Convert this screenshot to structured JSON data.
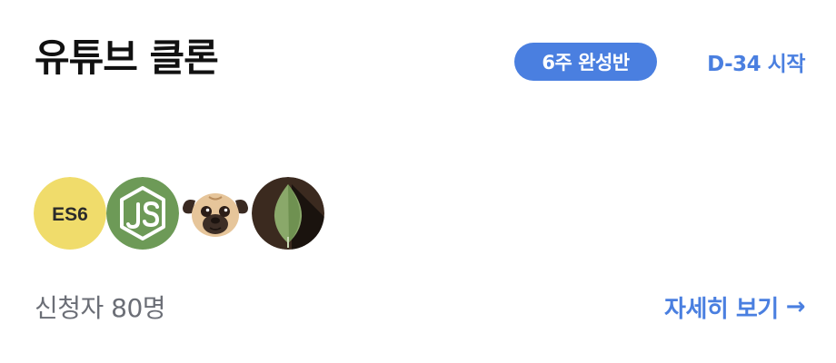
{
  "card": {
    "title": "유튜브 클론",
    "badge": "6주 완성반",
    "dday": "D-34 시작",
    "stack_icons": [
      "es6-icon",
      "nodejs-icon",
      "pug-icon",
      "mongodb-icon"
    ],
    "es6_label": "ES6",
    "applicants": "신청자 80명",
    "detail_label": "자세히 보기",
    "detail_arrow": "→"
  },
  "colors": {
    "accent": "#4a7fe0",
    "title": "#111111",
    "muted": "#6b6e76",
    "es6_bg": "#f0dc6b",
    "node_bg": "#6d9a57",
    "mongo_bg": "#3b2a1f",
    "mongo_leaf": "#8aa86a"
  }
}
